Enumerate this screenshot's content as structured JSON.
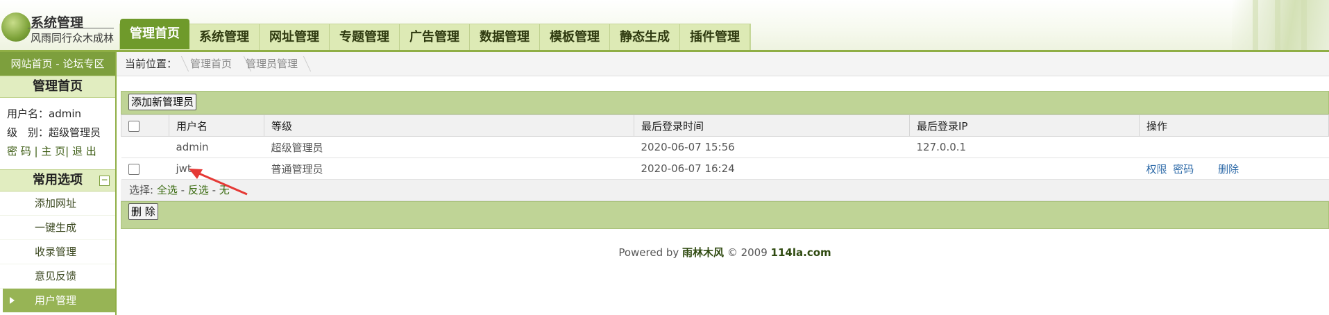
{
  "logo": {
    "title": "系统管理",
    "subtitle": "风雨同行众木成林"
  },
  "nav": {
    "tabs": [
      "管理首页",
      "系统管理",
      "网址管理",
      "专题管理",
      "广告管理",
      "数据管理",
      "模板管理",
      "静态生成",
      "插件管理"
    ],
    "active_index": 0
  },
  "sidebar": {
    "top_link": "网站首页 - 论坛专区",
    "section1": "管理首页",
    "user": {
      "username_label": "用户名：",
      "username": "admin",
      "level_label": "级　别：",
      "level": "超级管理员",
      "links": "密 码 | 主 页| 退 出"
    },
    "section2": "常用选项",
    "collapse_symbol": "−",
    "items": [
      "添加网址",
      "一键生成",
      "收录管理",
      "意见反馈",
      "用户管理"
    ],
    "active_item": "用户管理"
  },
  "breadcrumb": {
    "label": "当前位置：",
    "items": [
      "管理首页",
      "管理员管理"
    ]
  },
  "toolbar": {
    "add_button": "添加新管理员"
  },
  "table": {
    "headers": [
      "用户名",
      "等级",
      "最后登录时间",
      "最后登录IP",
      "操作"
    ],
    "rows": [
      {
        "username": "admin",
        "level": "超级管理员",
        "last_login": "2020-06-07 15:56",
        "ip": "127.0.0.1",
        "ops": [],
        "checkbox": false
      },
      {
        "username": "jwt",
        "level": "普通管理员",
        "last_login": "2020-06-07 16:24",
        "ip": "",
        "ops": [
          "权限",
          "密码",
          "删除"
        ],
        "checkbox": true
      }
    ]
  },
  "selection": {
    "label": "选择:",
    "all": "全选",
    "sep": " - ",
    "invert": "反选",
    "none": "无"
  },
  "bottom": {
    "delete_button": "删 除"
  },
  "footer": {
    "prefix": "Powered by ",
    "brand": "雨林木风",
    "copy": " © 2009 ",
    "site": "114la.com"
  },
  "colors": {
    "primary": "#6f9a2b",
    "bar": "#bfd496",
    "sidebar_top": "#7d9f3d",
    "annotation": "#e53935"
  }
}
